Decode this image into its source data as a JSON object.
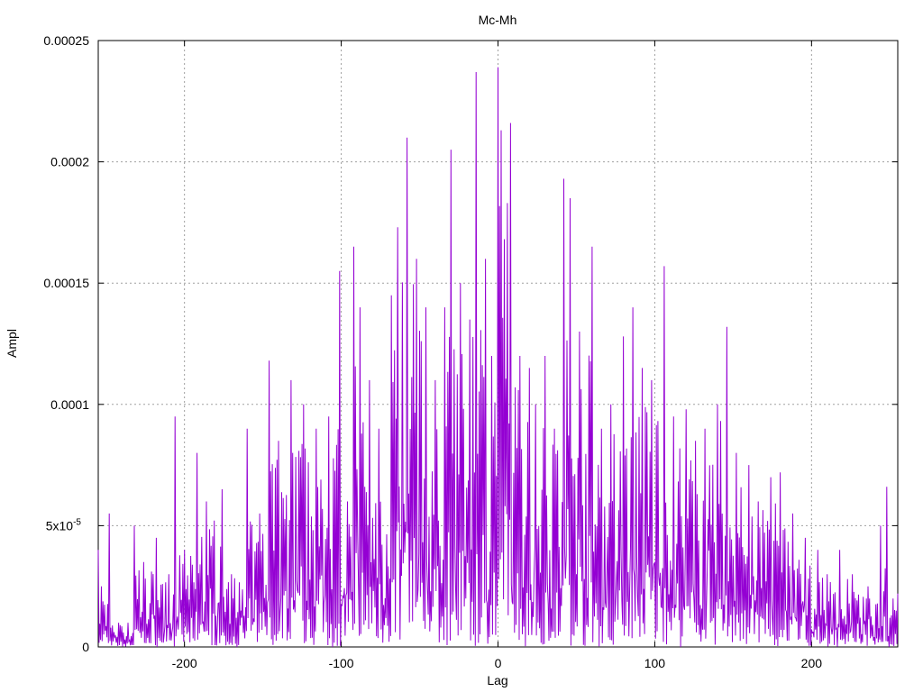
{
  "chart_data": {
    "type": "line",
    "title": "Mc-Mh",
    "xlabel": "Lag",
    "ylabel": "Ampl",
    "xlim": [
      -255,
      255
    ],
    "ylim": [
      0,
      0.00025
    ],
    "x_ticks": [
      -200,
      -100,
      0,
      100,
      200
    ],
    "x_tick_labels": [
      "-200",
      "-100",
      "0",
      "100",
      "200"
    ],
    "y_ticks": [
      0,
      5e-05,
      0.0001,
      0.00015,
      0.0002,
      0.00025
    ],
    "y_tick_labels": [
      "0",
      "5x10",
      "0.0001",
      "0.00015",
      "0.0002",
      "0.00025"
    ],
    "y_tick_exponent": "-5",
    "grid": true,
    "series": [
      {
        "color": "#9400d3",
        "peaks": [
          [
            -255,
            4e-05
          ],
          [
            -253,
            2.5e-05
          ],
          [
            -248,
            5.5e-05
          ],
          [
            -242,
            1e-05
          ],
          [
            -236,
            1e-05
          ],
          [
            -232,
            5e-05
          ],
          [
            -226,
            3.5e-05
          ],
          [
            -218,
            4.5e-05
          ],
          [
            -210,
            3e-05
          ],
          [
            -206,
            9.5e-05
          ],
          [
            -200,
            4e-05
          ],
          [
            -192,
            8e-05
          ],
          [
            -186,
            6e-05
          ],
          [
            -176,
            6.5e-05
          ],
          [
            -170,
            3e-05
          ],
          [
            -160,
            9e-05
          ],
          [
            -152,
            5.5e-05
          ],
          [
            -146,
            0.000118
          ],
          [
            -140,
            8.5e-05
          ],
          [
            -132,
            0.00011
          ],
          [
            -124,
            0.0001
          ],
          [
            -116,
            9e-05
          ],
          [
            -108,
            9.5e-05
          ],
          [
            -101,
            0.000155
          ],
          [
            -96,
            6e-05
          ],
          [
            -92,
            0.000165
          ],
          [
            -88,
            0.00014
          ],
          [
            -82,
            0.00011
          ],
          [
            -76,
            9e-05
          ],
          [
            -68,
            0.000145
          ],
          [
            -64,
            0.000173
          ],
          [
            -58,
            0.00021
          ],
          [
            -52,
            0.00016
          ],
          [
            -46,
            0.00014
          ],
          [
            -40,
            0.00011
          ],
          [
            -34,
            0.00014
          ],
          [
            -30,
            0.000205
          ],
          [
            -24,
            0.00015
          ],
          [
            -18,
            0.000135
          ],
          [
            -14,
            0.000237
          ],
          [
            -8,
            0.00016
          ],
          [
            -4,
            0.00012
          ],
          [
            0,
            0.000239
          ],
          [
            2,
            0.000213
          ],
          [
            6,
            0.000183
          ],
          [
            8,
            0.000216
          ],
          [
            14,
            0.00012
          ],
          [
            20,
            0.000115
          ],
          [
            24,
            0.0001
          ],
          [
            30,
            0.00012
          ],
          [
            36,
            9e-05
          ],
          [
            42,
            0.000193
          ],
          [
            46,
            0.000185
          ],
          [
            52,
            0.00013
          ],
          [
            60,
            0.000165
          ],
          [
            66,
            9e-05
          ],
          [
            72,
            0.0001
          ],
          [
            80,
            0.000128
          ],
          [
            86,
            0.00014
          ],
          [
            92,
            0.000115
          ],
          [
            98,
            0.00011
          ],
          [
            106,
            0.000157
          ],
          [
            112,
            9.5e-05
          ],
          [
            120,
            9.8e-05
          ],
          [
            126,
            8.5e-05
          ],
          [
            132,
            9e-05
          ],
          [
            140,
            0.0001
          ],
          [
            146,
            0.000132
          ],
          [
            152,
            8e-05
          ],
          [
            160,
            7.5e-05
          ],
          [
            166,
            6e-05
          ],
          [
            174,
            7e-05
          ],
          [
            180,
            7.2e-05
          ],
          [
            188,
            5.5e-05
          ],
          [
            196,
            4.5e-05
          ],
          [
            204,
            4e-05
          ],
          [
            210,
            3e-05
          ],
          [
            218,
            4e-05
          ],
          [
            226,
            3e-05
          ],
          [
            236,
            2.5e-05
          ],
          [
            244,
            5e-05
          ],
          [
            248,
            6.6e-05
          ],
          [
            252,
            2e-05
          ],
          [
            255,
            2.2e-05
          ]
        ]
      }
    ]
  }
}
